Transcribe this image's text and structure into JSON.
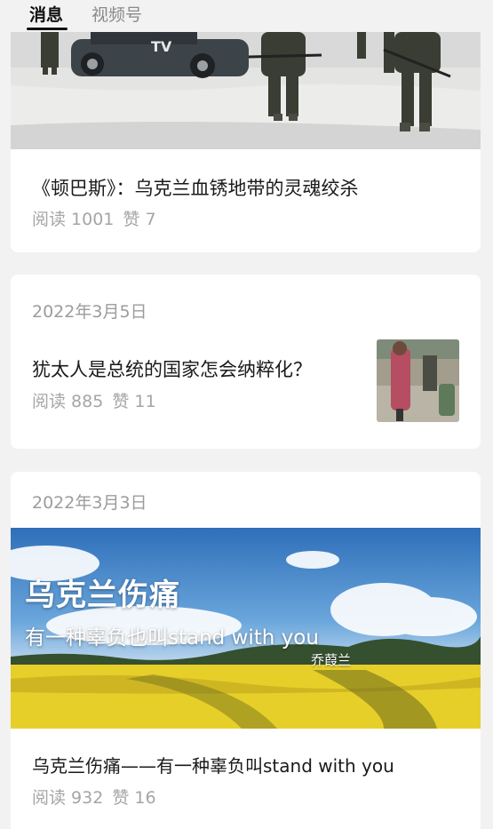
{
  "tabs": {
    "active": "消息",
    "inactive": "视频号"
  },
  "articles": [
    {
      "image_caption": "TV",
      "title": "《顿巴斯》：乌克兰血锈地带的灵魂绞杀",
      "reads": "阅读 1001",
      "likes": "赞 7"
    },
    {
      "date": "2022年3月5日",
      "title": "犹太人是总统的国家怎会纳粹化？",
      "reads": "阅读 885",
      "likes": "赞 11"
    },
    {
      "date": "2022年3月3日",
      "banner_title": "乌克兰伤痛",
      "banner_subtitle": "有一种辜负也叫stand with you",
      "banner_author": "乔葭兰",
      "title": "乌克兰伤痛——有一种辜负叫stand with you",
      "reads": "阅读 932",
      "likes": "赞 16"
    }
  ]
}
